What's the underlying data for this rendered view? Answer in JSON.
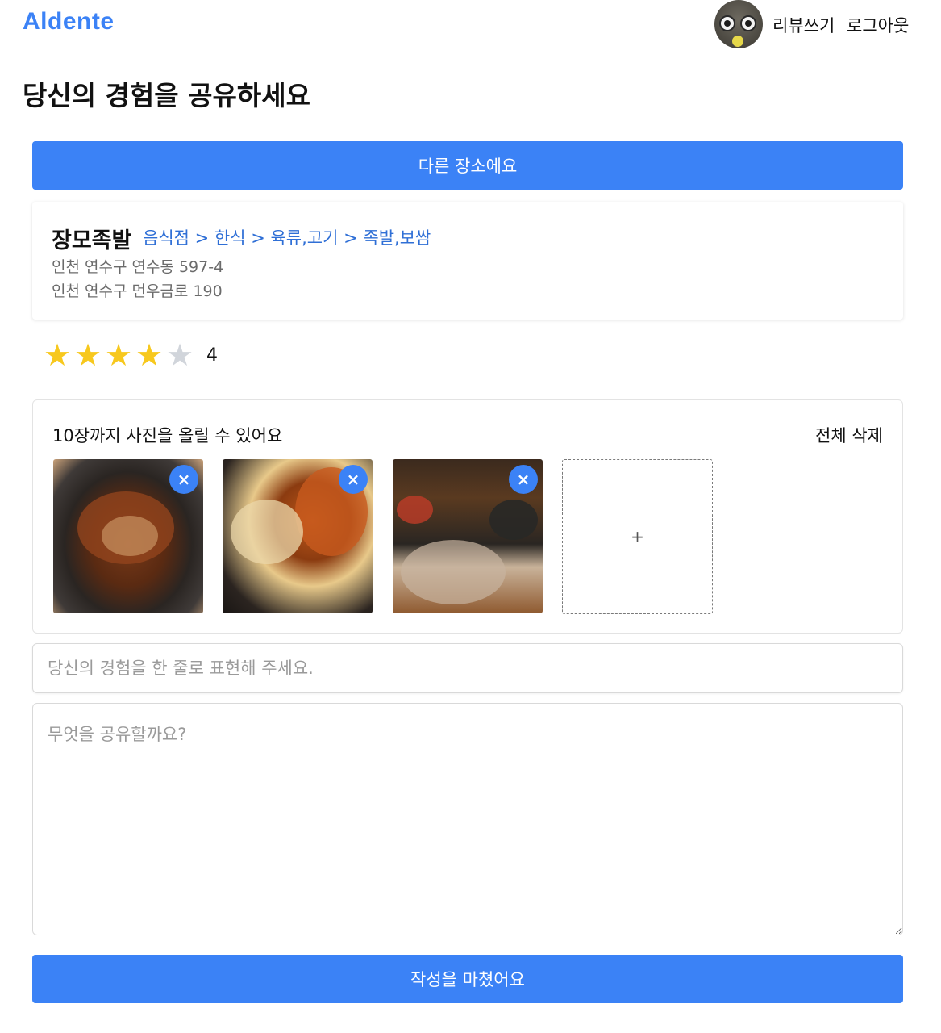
{
  "header": {
    "logo": "Aldente",
    "nav_review": "리뷰쓰기",
    "nav_logout": "로그아웃"
  },
  "page_title": "당신의 경험을 공유하세요",
  "other_place_button": "다른 장소에요",
  "place": {
    "name": "장모족발",
    "category": "음식점 > 한식 > 육류,고기 > 족발,보쌈",
    "address_lot": "인천 연수구 연수동 597-4",
    "address_road": "인천 연수구 먼우금로 190"
  },
  "rating": {
    "value": 4,
    "max": 5,
    "label": "4",
    "star_color": "#f7c81d"
  },
  "photos": {
    "hint": "10장까지 사진을 올릴 수 있어요",
    "delete_all": "전체 삭제",
    "remove_glyph": "×",
    "add_glyph": "+",
    "count": 3
  },
  "form": {
    "oneline_placeholder": "당신의 경험을 한 줄로 표현해 주세요.",
    "content_placeholder": "무엇을 공유할까요?"
  },
  "submit_button": "작성을 마쳤어요",
  "colors": {
    "accent": "#3b82f6",
    "category_link": "#2f6fd6"
  }
}
